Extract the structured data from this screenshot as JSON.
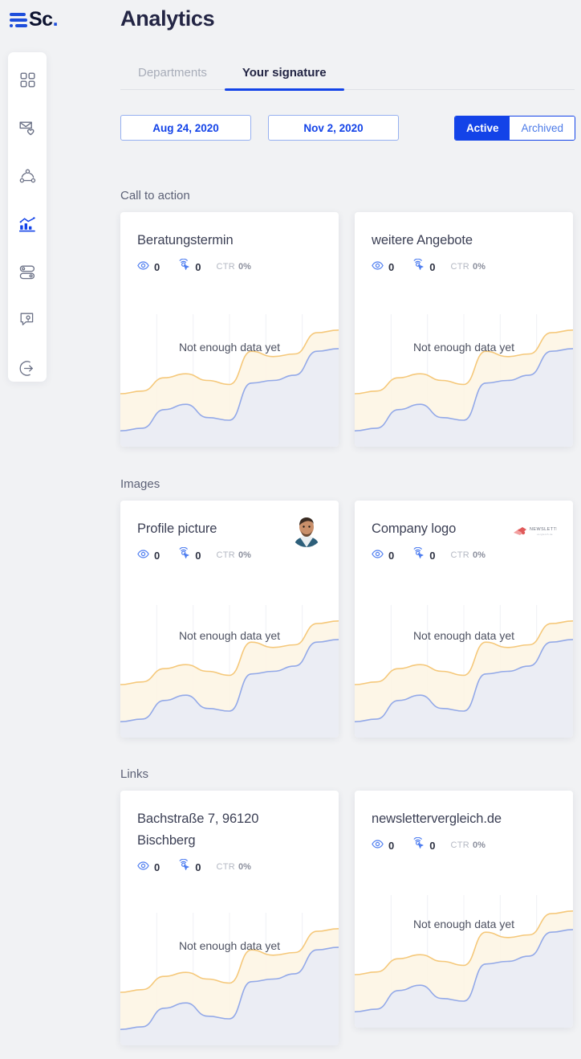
{
  "brand": {
    "mark": "bars-logo",
    "word": "Sc",
    "word_dot": "."
  },
  "header": {
    "title": "Analytics"
  },
  "sidebar": {
    "items": [
      {
        "name": "dashboard",
        "icon": "grid-icon",
        "active": false
      },
      {
        "name": "campaigns",
        "icon": "mail-heart-icon",
        "active": false
      },
      {
        "name": "team",
        "icon": "users-network-icon",
        "active": false
      },
      {
        "name": "analytics",
        "icon": "bar-chart-icon",
        "active": true
      },
      {
        "name": "integrations",
        "icon": "toggles-icon",
        "active": false
      },
      {
        "name": "feedback",
        "icon": "chat-location-icon",
        "active": false
      },
      {
        "name": "logout",
        "icon": "logout-icon",
        "active": false
      }
    ],
    "active_color": "#1343e8",
    "idle_color": "#6b7186"
  },
  "tabs": [
    {
      "label": "Departments",
      "active": false
    },
    {
      "label": "Your signature",
      "active": true
    }
  ],
  "filters": {
    "date_start": "Aug 24, 2020",
    "date_end": "Nov 2, 2020",
    "status_active": "Active",
    "status_archived": "Archived",
    "selected_status": "Active"
  },
  "stat_labels": {
    "views_icon": "eye-icon",
    "clicks_icon": "click-icon",
    "ctr_label": "CTR"
  },
  "empty_text": "Not enough data yet",
  "sections": [
    {
      "title": "Call to action",
      "cards": [
        {
          "title": "Beratungstermin",
          "views": "0",
          "clicks": "0",
          "ctr": "0%",
          "thumb": null
        },
        {
          "title": "weitere Angebote",
          "views": "0",
          "clicks": "0",
          "ctr": "0%",
          "thumb": null
        }
      ]
    },
    {
      "title": "Images",
      "cards": [
        {
          "title": "Profile picture",
          "views": "0",
          "clicks": "0",
          "ctr": "0%",
          "thumb": "profile-photo"
        },
        {
          "title": "Company logo",
          "views": "0",
          "clicks": "0",
          "ctr": "0%",
          "thumb": "newsletter-logo"
        }
      ]
    },
    {
      "title": "Links",
      "cards": [
        {
          "title": "Bachstraße 7, 96120 Bischberg",
          "views": "0",
          "clicks": "0",
          "ctr": "0%",
          "thumb": null
        },
        {
          "title": "newslettervergleich.de",
          "views": "0",
          "clicks": "0",
          "ctr": "0%",
          "thumb": null
        }
      ]
    }
  ],
  "chart_data": {
    "type": "area",
    "title": "",
    "xlabel": "",
    "ylabel": "",
    "grid": true,
    "annotations": [
      "Not enough data yet"
    ],
    "x": [
      0,
      1,
      2,
      3,
      4,
      5,
      6,
      7,
      8,
      9,
      10
    ],
    "series": [
      {
        "name": "views",
        "color": "#f5c87a",
        "fill": "#fdf4e3",
        "values": [
          40,
          42,
          52,
          55,
          50,
          47,
          72,
          68,
          70,
          86,
          88
        ]
      },
      {
        "name": "clicks",
        "color": "#93a9e8",
        "fill": "#e8ebf6",
        "values": [
          12,
          14,
          28,
          32,
          22,
          20,
          48,
          50,
          54,
          72,
          74
        ]
      }
    ],
    "ylim": [
      0,
      100
    ]
  },
  "colors": {
    "accent": "#1343e8",
    "page_bg": "#f1f2f4",
    "card_bg": "#ffffff",
    "text": "#232544",
    "muted": "#a8adb9"
  }
}
